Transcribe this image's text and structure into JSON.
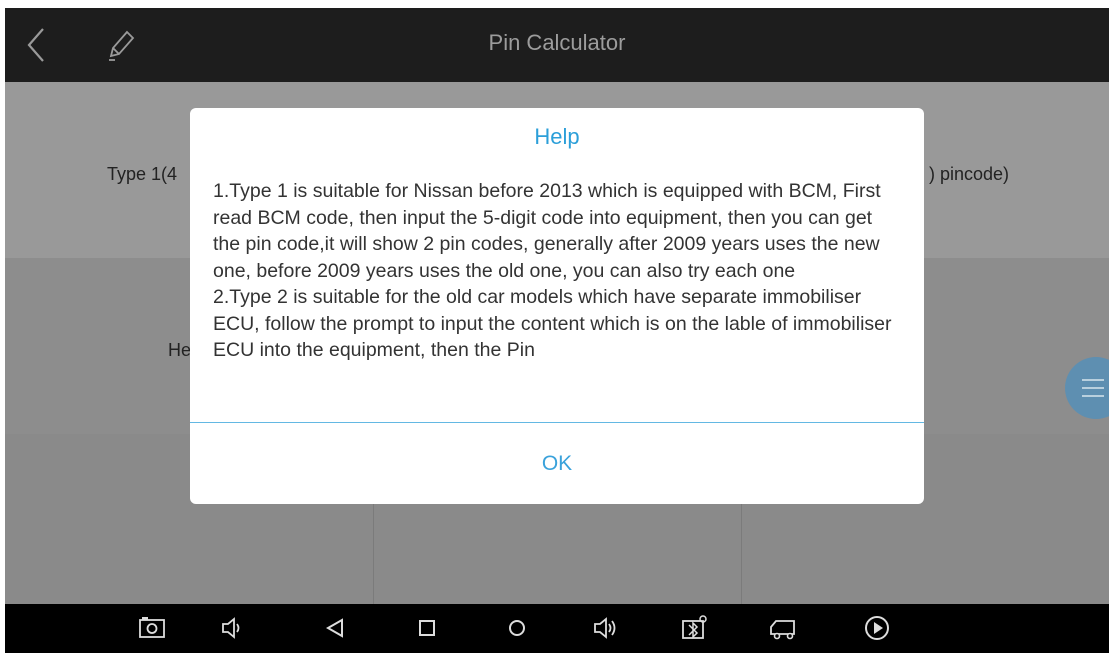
{
  "app": {
    "title": "Pin Calculator"
  },
  "grid": {
    "type1_label": "Type 1(4",
    "type2_label": ") pincode)",
    "help_label": "He"
  },
  "dialog": {
    "title": "Help",
    "paragraphs": [
      "1.Type 1 is suitable for Nissan before 2013 which is equipped with BCM, First read BCM code, then input the 5-digit code into equipment, then you can get the pin code,it will show 2 pin codes, generally after 2009 years uses the new one, before 2009 years uses the old one, you can also try each one",
      "2.Type 2 is suitable for the old car models which have separate immobiliser ECU, follow the prompt to input the content which is on the lable of immobiliser ECU into the equipment, then the Pin"
    ],
    "ok_label": "OK"
  },
  "navbar": {
    "icons": [
      "screenshot-icon",
      "volume-down-icon",
      "back-triangle-icon",
      "recent-apps-icon",
      "home-circle-icon",
      "volume-up-icon",
      "bluetooth-vci-icon",
      "vehicle-icon",
      "play-icon"
    ]
  },
  "colors": {
    "accent": "#2c9fd9",
    "topbar": "#1d1d1d",
    "navbar": "#000000"
  }
}
